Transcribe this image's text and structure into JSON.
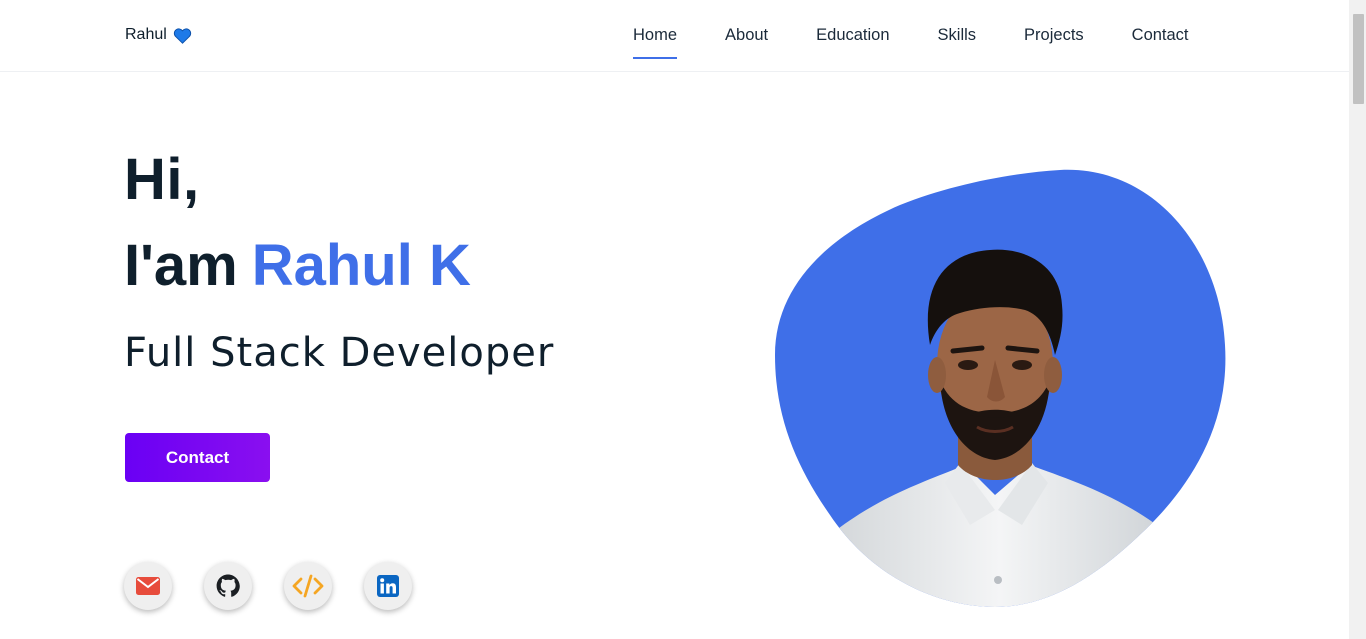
{
  "brand": {
    "name": "Rahul",
    "icon": "blue-heart-icon",
    "heart_color": "#1e7ae8"
  },
  "nav": {
    "items": [
      {
        "label": "Home",
        "active": true
      },
      {
        "label": "About"
      },
      {
        "label": "Education"
      },
      {
        "label": "Skills"
      },
      {
        "label": "Projects"
      },
      {
        "label": "Contact"
      }
    ],
    "active_color": "#3f6fe8"
  },
  "hero": {
    "greeting": "Hi,",
    "intro": "I'am",
    "name": "Rahul K",
    "role": "Full Stack Developer",
    "cta_label": "Contact",
    "name_color": "#3f6fe8",
    "blob_color": "#3f6fe8"
  },
  "socials": [
    {
      "name": "email",
      "icon": "mail-icon",
      "color": "#e74c3c"
    },
    {
      "name": "github",
      "icon": "github-icon",
      "color": "#1b1f23"
    },
    {
      "name": "code",
      "icon": "code-icon",
      "color": "#f5a623"
    },
    {
      "name": "linkedin",
      "icon": "linkedin-icon",
      "color": "#0a66c2"
    }
  ]
}
